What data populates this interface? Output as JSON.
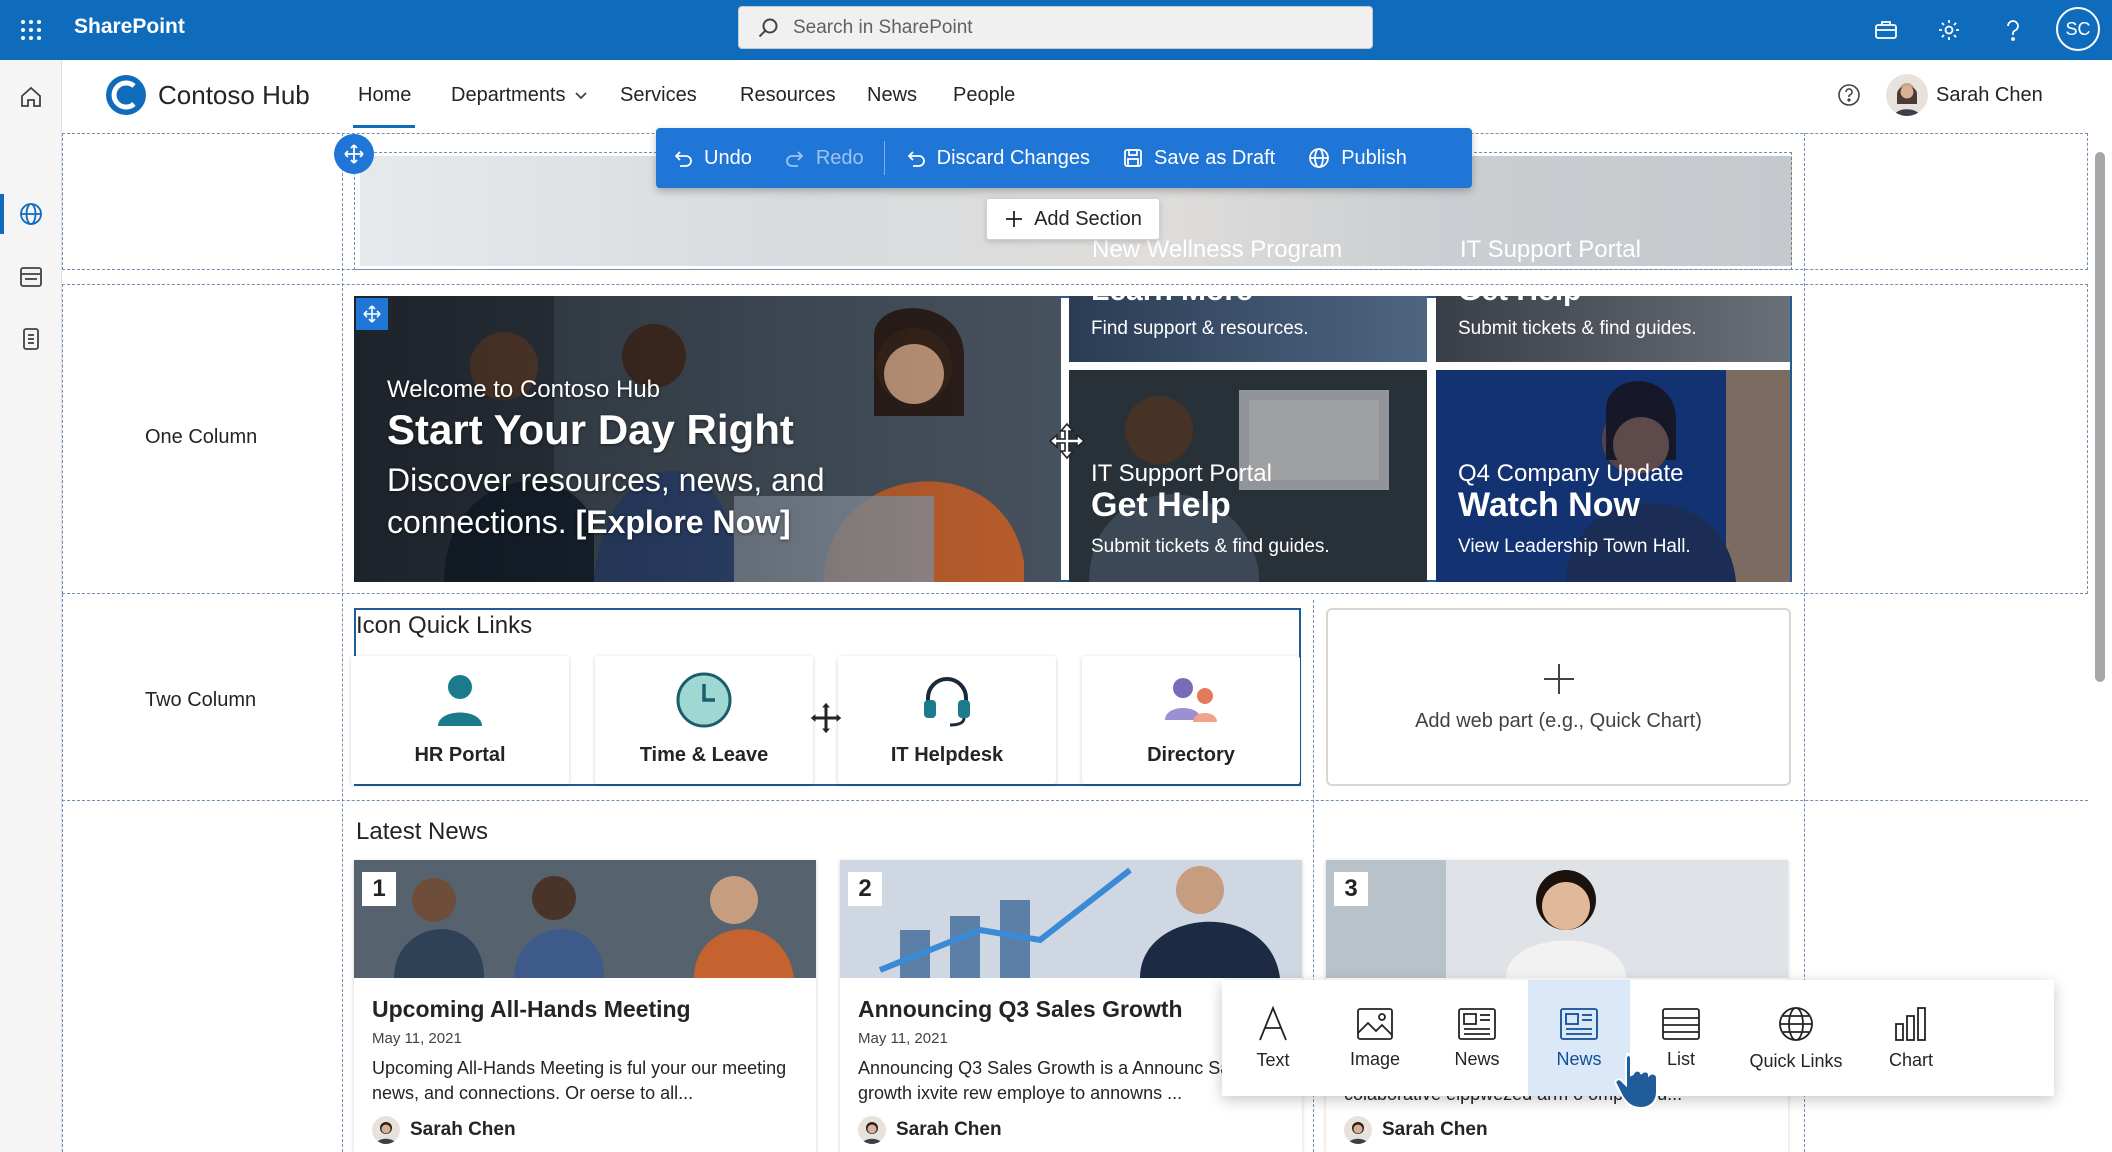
{
  "suite": {
    "app_name": "SharePoint",
    "search_placeholder": "Search in SharePoint",
    "user_initials": "SC"
  },
  "site": {
    "title": "Contoso Hub",
    "nav": [
      "Home",
      "Departments",
      "Services",
      "Resources",
      "News",
      "People"
    ],
    "user_name": "Sarah Chen"
  },
  "toolbar": {
    "undo": "Undo",
    "redo": "Redo",
    "discard": "Discard Changes",
    "save_draft": "Save as Draft",
    "publish": "Publish"
  },
  "add_section": "Add Section",
  "faded_section": {
    "tile1": "New Wellness Program",
    "tile2": "IT Support Portal"
  },
  "section_labels": {
    "one_column": "One Column",
    "two_column": "Two Column"
  },
  "hero": {
    "kicker": "Welcome to Contoso Hub",
    "title": "Start Your Day Right",
    "body_line1": "Discover resources, news, and",
    "body_line2_plain": "connections.",
    "body_line2_bold": "[Explore Now]",
    "top_tile1_title": "Learn More",
    "top_tile1_desc": "Find support & resources.",
    "top_tile2_title": "Get Help",
    "top_tile2_desc": "Submit tickets & find guides.",
    "tile3_kicker": "IT Support Portal",
    "tile3_title": "Get Help",
    "tile3_desc": "Submit tickets & find guides.",
    "tile4_kicker": "Q4 Company Update",
    "tile4_title": "Watch Now",
    "tile4_desc": "View Leadership Town Hall."
  },
  "quick_links": {
    "title": "Icon Quick Links",
    "items": [
      "HR Portal",
      "Time & Leave",
      "IT Helpdesk",
      "Directory"
    ]
  },
  "add_web_part": "Add web part (e.g., Quick Chart)",
  "news": {
    "title": "Latest News",
    "items": [
      {
        "num": "1",
        "headline": "Upcoming All-Hands Meeting",
        "date": "May 11, 2021",
        "body": "Upcoming All-Hands Meeting is ful your our meeting news, and connections. Or oerse to all...",
        "author": "Sarah Chen"
      },
      {
        "num": "2",
        "headline": "Announcing Q3 Sales Growth",
        "date": "May 11, 2021",
        "body": "Announcing Q3 Sales Growth is a Announc Sales growth ixvite rew employe to annowns ...",
        "author": "Sarah Chen"
      },
      {
        "num": "3",
        "headline": "",
        "date": "",
        "body": "colaborative eippwezed arm o ompany u...",
        "author": "Sarah Chen"
      }
    ]
  },
  "picker": {
    "items": [
      "Text",
      "Image",
      "News",
      "News",
      "List",
      "Quick Links",
      "Chart"
    ],
    "selected": "News"
  },
  "colors": {
    "suite_blue": "#0f6cbd",
    "toolbar_blue": "#1f76d6",
    "teal_icon": "#1b7b8c",
    "guide_dash": "#6f8fb3"
  }
}
